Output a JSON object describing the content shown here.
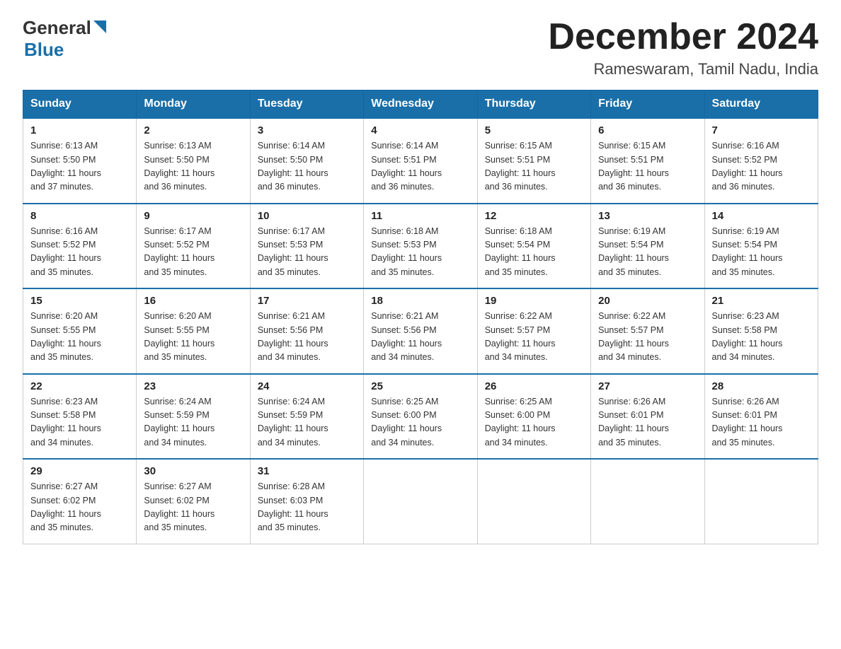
{
  "header": {
    "logo_general": "General",
    "logo_blue": "Blue",
    "month_title": "December 2024",
    "location": "Rameswaram, Tamil Nadu, India"
  },
  "weekdays": [
    "Sunday",
    "Monday",
    "Tuesday",
    "Wednesday",
    "Thursday",
    "Friday",
    "Saturday"
  ],
  "weeks": [
    [
      {
        "day": "1",
        "sunrise": "6:13 AM",
        "sunset": "5:50 PM",
        "daylight": "11 hours and 37 minutes."
      },
      {
        "day": "2",
        "sunrise": "6:13 AM",
        "sunset": "5:50 PM",
        "daylight": "11 hours and 36 minutes."
      },
      {
        "day": "3",
        "sunrise": "6:14 AM",
        "sunset": "5:50 PM",
        "daylight": "11 hours and 36 minutes."
      },
      {
        "day": "4",
        "sunrise": "6:14 AM",
        "sunset": "5:51 PM",
        "daylight": "11 hours and 36 minutes."
      },
      {
        "day": "5",
        "sunrise": "6:15 AM",
        "sunset": "5:51 PM",
        "daylight": "11 hours and 36 minutes."
      },
      {
        "day": "6",
        "sunrise": "6:15 AM",
        "sunset": "5:51 PM",
        "daylight": "11 hours and 36 minutes."
      },
      {
        "day": "7",
        "sunrise": "6:16 AM",
        "sunset": "5:52 PM",
        "daylight": "11 hours and 36 minutes."
      }
    ],
    [
      {
        "day": "8",
        "sunrise": "6:16 AM",
        "sunset": "5:52 PM",
        "daylight": "11 hours and 35 minutes."
      },
      {
        "day": "9",
        "sunrise": "6:17 AM",
        "sunset": "5:52 PM",
        "daylight": "11 hours and 35 minutes."
      },
      {
        "day": "10",
        "sunrise": "6:17 AM",
        "sunset": "5:53 PM",
        "daylight": "11 hours and 35 minutes."
      },
      {
        "day": "11",
        "sunrise": "6:18 AM",
        "sunset": "5:53 PM",
        "daylight": "11 hours and 35 minutes."
      },
      {
        "day": "12",
        "sunrise": "6:18 AM",
        "sunset": "5:54 PM",
        "daylight": "11 hours and 35 minutes."
      },
      {
        "day": "13",
        "sunrise": "6:19 AM",
        "sunset": "5:54 PM",
        "daylight": "11 hours and 35 minutes."
      },
      {
        "day": "14",
        "sunrise": "6:19 AM",
        "sunset": "5:54 PM",
        "daylight": "11 hours and 35 minutes."
      }
    ],
    [
      {
        "day": "15",
        "sunrise": "6:20 AM",
        "sunset": "5:55 PM",
        "daylight": "11 hours and 35 minutes."
      },
      {
        "day": "16",
        "sunrise": "6:20 AM",
        "sunset": "5:55 PM",
        "daylight": "11 hours and 35 minutes."
      },
      {
        "day": "17",
        "sunrise": "6:21 AM",
        "sunset": "5:56 PM",
        "daylight": "11 hours and 34 minutes."
      },
      {
        "day": "18",
        "sunrise": "6:21 AM",
        "sunset": "5:56 PM",
        "daylight": "11 hours and 34 minutes."
      },
      {
        "day": "19",
        "sunrise": "6:22 AM",
        "sunset": "5:57 PM",
        "daylight": "11 hours and 34 minutes."
      },
      {
        "day": "20",
        "sunrise": "6:22 AM",
        "sunset": "5:57 PM",
        "daylight": "11 hours and 34 minutes."
      },
      {
        "day": "21",
        "sunrise": "6:23 AM",
        "sunset": "5:58 PM",
        "daylight": "11 hours and 34 minutes."
      }
    ],
    [
      {
        "day": "22",
        "sunrise": "6:23 AM",
        "sunset": "5:58 PM",
        "daylight": "11 hours and 34 minutes."
      },
      {
        "day": "23",
        "sunrise": "6:24 AM",
        "sunset": "5:59 PM",
        "daylight": "11 hours and 34 minutes."
      },
      {
        "day": "24",
        "sunrise": "6:24 AM",
        "sunset": "5:59 PM",
        "daylight": "11 hours and 34 minutes."
      },
      {
        "day": "25",
        "sunrise": "6:25 AM",
        "sunset": "6:00 PM",
        "daylight": "11 hours and 34 minutes."
      },
      {
        "day": "26",
        "sunrise": "6:25 AM",
        "sunset": "6:00 PM",
        "daylight": "11 hours and 34 minutes."
      },
      {
        "day": "27",
        "sunrise": "6:26 AM",
        "sunset": "6:01 PM",
        "daylight": "11 hours and 35 minutes."
      },
      {
        "day": "28",
        "sunrise": "6:26 AM",
        "sunset": "6:01 PM",
        "daylight": "11 hours and 35 minutes."
      }
    ],
    [
      {
        "day": "29",
        "sunrise": "6:27 AM",
        "sunset": "6:02 PM",
        "daylight": "11 hours and 35 minutes."
      },
      {
        "day": "30",
        "sunrise": "6:27 AM",
        "sunset": "6:02 PM",
        "daylight": "11 hours and 35 minutes."
      },
      {
        "day": "31",
        "sunrise": "6:28 AM",
        "sunset": "6:03 PM",
        "daylight": "11 hours and 35 minutes."
      },
      null,
      null,
      null,
      null
    ]
  ],
  "labels": {
    "sunrise": "Sunrise: ",
    "sunset": "Sunset: ",
    "daylight": "Daylight: "
  }
}
